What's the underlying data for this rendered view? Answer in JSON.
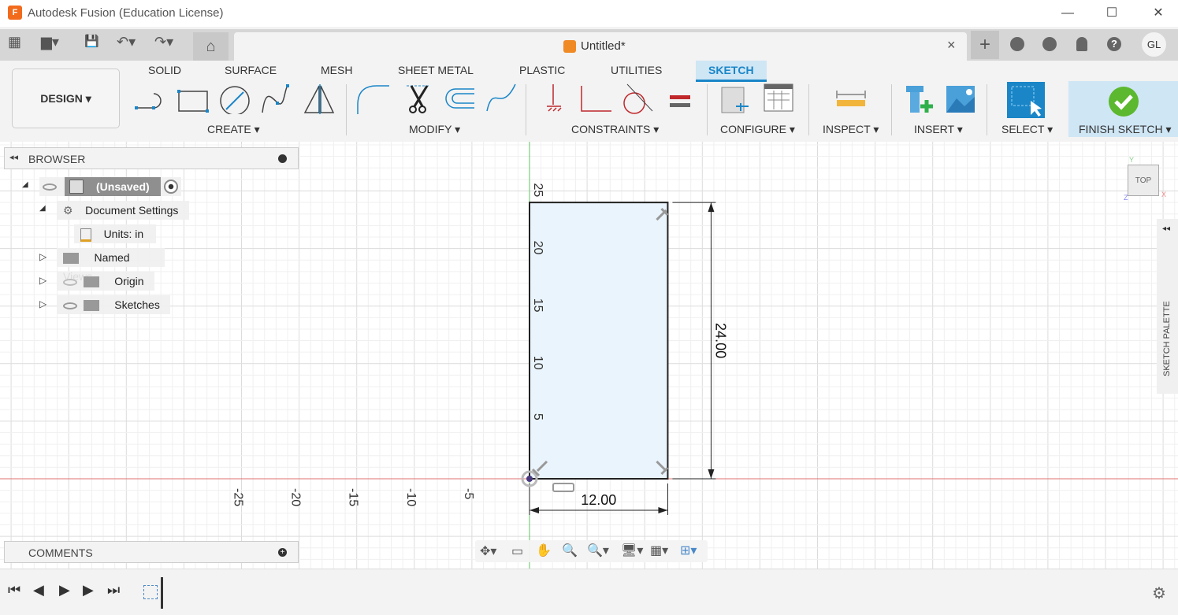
{
  "app": {
    "title": "Autodesk Fusion (Education License)",
    "logo_text": "F"
  },
  "window_controls": {
    "minimize": "—",
    "maximize": "☐",
    "close": "✕"
  },
  "quick_access": {
    "grid": "▦",
    "file": "▆▾",
    "save": "💾",
    "undo": "↶▾",
    "redo": "↷▾",
    "home": "⌂"
  },
  "document_tab": {
    "name": "Untitled*",
    "close": "×"
  },
  "right_icons": {
    "new_tab": "+",
    "user_initials": "GL"
  },
  "workspace": {
    "label": "DESIGN ▾"
  },
  "ribbon_tabs": [
    {
      "label": "SOLID"
    },
    {
      "label": "SURFACE"
    },
    {
      "label": "MESH"
    },
    {
      "label": "SHEET METAL"
    },
    {
      "label": "PLASTIC"
    },
    {
      "label": "UTILITIES"
    },
    {
      "label": "SKETCH",
      "active": true
    }
  ],
  "groups": {
    "create": "CREATE ▾",
    "modify": "MODIFY ▾",
    "constraints": "CONSTRAINTS ▾",
    "configure": "CONFIGURE ▾",
    "inspect": "INSPECT ▾",
    "insert": "INSERT ▾",
    "select": "SELECT ▾",
    "finish": "FINISH SKETCH ▾"
  },
  "browser": {
    "title": "BROWSER",
    "items": [
      {
        "label": "(Unsaved)"
      },
      {
        "label": "Document Settings"
      },
      {
        "label": "Units: in"
      },
      {
        "label": "Named Views"
      },
      {
        "label": "Origin"
      },
      {
        "label": "Sketches"
      }
    ]
  },
  "comments": {
    "title": "COMMENTS"
  },
  "viewcube": {
    "face": "TOP",
    "x": "X",
    "y": "Y",
    "z": "Z"
  },
  "sketch_palette": {
    "label": "SKETCH PALETTE"
  },
  "sketch": {
    "x_axis_labels": [
      "-25",
      "-20",
      "-15",
      "-10",
      "-5"
    ],
    "y_axis_labels": [
      "25",
      "20",
      "15",
      "10",
      "5"
    ],
    "rectangle": {
      "width": 12,
      "height": 24,
      "units": "in"
    },
    "dimensions": {
      "width": "12.00",
      "height": "24.00"
    }
  },
  "colors": {
    "accent": "#1a86c8",
    "x_axis": "#e07070",
    "y_axis": "#60c060",
    "sketch_fill": "#eaf4fc",
    "finish_check": "#5cb82e"
  }
}
